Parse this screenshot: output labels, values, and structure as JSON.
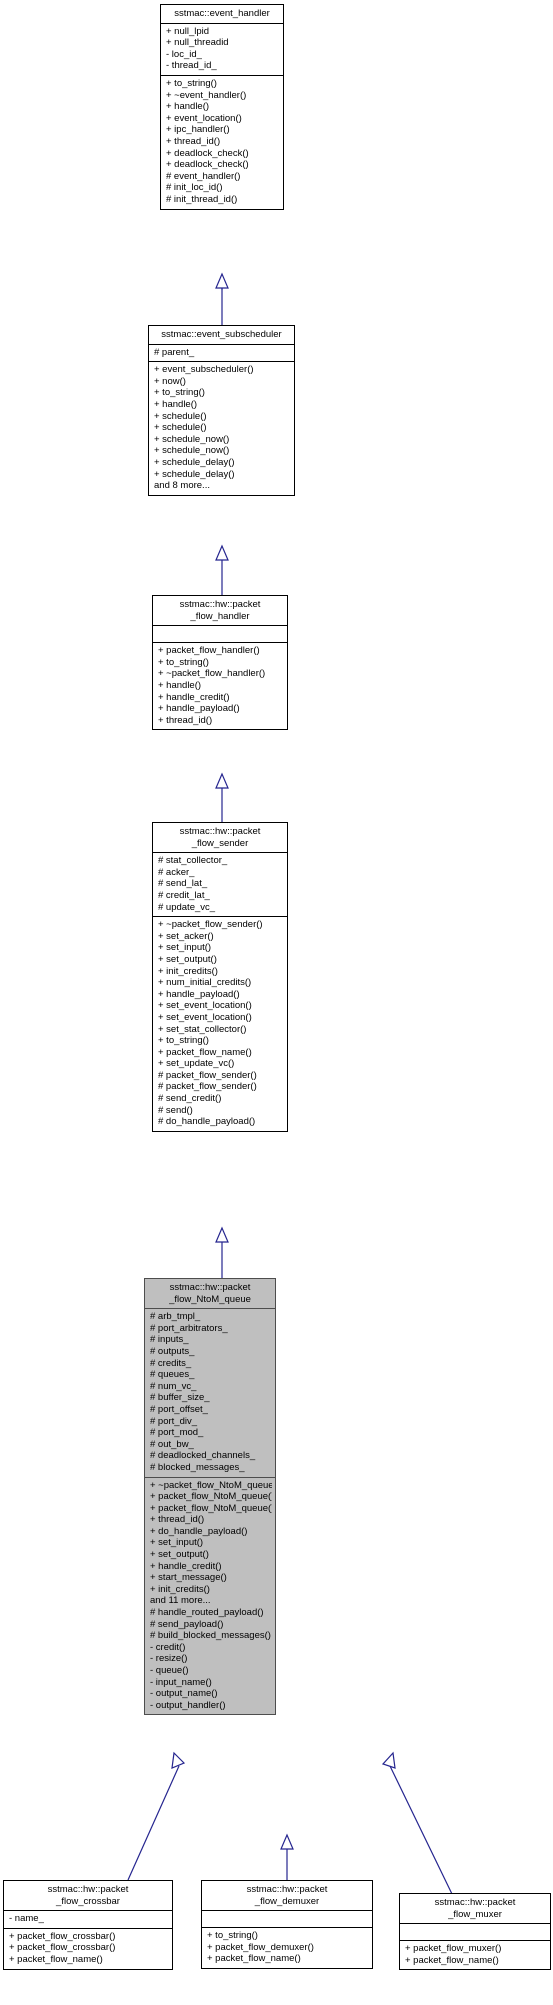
{
  "diagram": {
    "type": "uml-class-inheritance",
    "edge_color": "#25258f",
    "highlight_fill": "#bfbfbf",
    "relation_label": "inheritance"
  },
  "classes": [
    {
      "id": "event_handler",
      "title": "sstmac::event_handler",
      "highlighted": false,
      "attributes": [
        "+ null_lpid",
        "+ null_threadid",
        "- loc_id_",
        "- thread_id_"
      ],
      "methods": [
        "+ to_string()",
        "+ ~event_handler()",
        "+ handle()",
        "+ event_location()",
        "+ ipc_handler()",
        "+ thread_id()",
        "+ deadlock_check()",
        "+ deadlock_check()",
        "# event_handler()",
        "# init_loc_id()",
        "# init_thread_id()"
      ]
    },
    {
      "id": "event_subscheduler",
      "title": "sstmac::event_subscheduler",
      "highlighted": false,
      "attributes": [
        "# parent_"
      ],
      "methods": [
        "+ event_subscheduler()",
        "+ now()",
        "+ to_string()",
        "+ handle()",
        "+ schedule()",
        "+ schedule()",
        "+ schedule_now()",
        "+ schedule_now()",
        "+ schedule_delay()",
        "+ schedule_delay()",
        "and 8 more..."
      ]
    },
    {
      "id": "packet_flow_handler",
      "title": "sstmac::hw::packet\n_flow_handler",
      "highlighted": false,
      "attributes": [],
      "methods": [
        "+ packet_flow_handler()",
        "+ to_string()",
        "+ ~packet_flow_handler()",
        "+ handle()",
        "+ handle_credit()",
        "+ handle_payload()",
        "+ thread_id()"
      ]
    },
    {
      "id": "packet_flow_sender",
      "title": "sstmac::hw::packet\n_flow_sender",
      "highlighted": false,
      "attributes": [
        "# stat_collector_",
        "# acker_",
        "# send_lat_",
        "# credit_lat_",
        "# update_vc_"
      ],
      "methods": [
        "+ ~packet_flow_sender()",
        "+ set_acker()",
        "+ set_input()",
        "+ set_output()",
        "+ init_credits()",
        "+ num_initial_credits()",
        "+ handle_payload()",
        "+ set_event_location()",
        "+ set_event_location()",
        "+ set_stat_collector()",
        "+ to_string()",
        "+ packet_flow_name()",
        "+ set_update_vc()",
        "# packet_flow_sender()",
        "# packet_flow_sender()",
        "# send_credit()",
        "# send()",
        "# do_handle_payload()"
      ]
    },
    {
      "id": "packet_flow_NtoM_queue",
      "title": "sstmac::hw::packet\n_flow_NtoM_queue",
      "highlighted": true,
      "attributes": [
        "# arb_tmpl_",
        "# port_arbitrators_",
        "# inputs_",
        "# outputs_",
        "# credits_",
        "# queues_",
        "# num_vc_",
        "# buffer_size_",
        "# port_offset_",
        "# port_div_",
        "# port_mod_",
        "# out_bw_",
        "# deadlocked_channels_",
        "# blocked_messages_"
      ],
      "methods": [
        "+ ~packet_flow_NtoM_queue()",
        "+ packet_flow_NtoM_queue()",
        "+ packet_flow_NtoM_queue()",
        "+ thread_id()",
        "+ do_handle_payload()",
        "+ set_input()",
        "+ set_output()",
        "+ handle_credit()",
        "+ start_message()",
        "+ init_credits()",
        "and 11 more...",
        "# handle_routed_payload()",
        "# send_payload()",
        "# build_blocked_messages()",
        "- credit()",
        "- resize()",
        "- queue()",
        "- input_name()",
        "- output_name()",
        "- output_handler()"
      ]
    },
    {
      "id": "packet_flow_crossbar",
      "title": "sstmac::hw::packet\n_flow_crossbar",
      "highlighted": false,
      "attributes": [
        "- name_"
      ],
      "methods": [
        "+ packet_flow_crossbar()",
        "+ packet_flow_crossbar()",
        "+ packet_flow_name()"
      ]
    },
    {
      "id": "packet_flow_demuxer",
      "title": "sstmac::hw::packet\n_flow_demuxer",
      "highlighted": false,
      "attributes": [],
      "methods": [
        "+ to_string()",
        "+ packet_flow_demuxer()",
        "+ packet_flow_name()"
      ]
    },
    {
      "id": "packet_flow_muxer",
      "title": "sstmac::hw::packet\n_flow_muxer",
      "highlighted": false,
      "attributes": [],
      "methods": [
        "+ packet_flow_muxer()",
        "+ packet_flow_name()"
      ]
    }
  ],
  "edges": [
    {
      "from": "event_subscheduler",
      "to": "event_handler"
    },
    {
      "from": "packet_flow_handler",
      "to": "event_subscheduler"
    },
    {
      "from": "packet_flow_sender",
      "to": "packet_flow_handler"
    },
    {
      "from": "packet_flow_NtoM_queue",
      "to": "packet_flow_sender"
    },
    {
      "from": "packet_flow_crossbar",
      "to": "packet_flow_NtoM_queue"
    },
    {
      "from": "packet_flow_demuxer",
      "to": "packet_flow_NtoM_queue"
    },
    {
      "from": "packet_flow_muxer",
      "to": "packet_flow_NtoM_queue"
    }
  ]
}
